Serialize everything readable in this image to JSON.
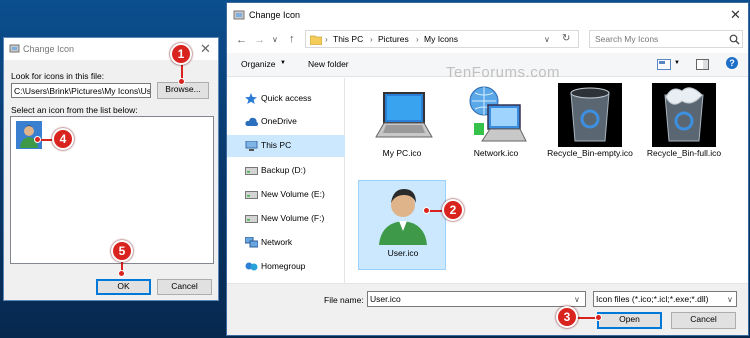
{
  "small_dialog": {
    "title": "Change Icon",
    "look_label": "Look for icons in this file:",
    "file_path": "C:\\Users\\Brink\\Pictures\\My Icons\\Use",
    "browse_label": "Browse...",
    "list_label": "Select an icon from the list below:",
    "ok_label": "OK",
    "cancel_label": "Cancel"
  },
  "open_dialog": {
    "title": "Change Icon",
    "breadcrumb": [
      "This PC",
      "Pictures",
      "My Icons"
    ],
    "search_placeholder": "Search My Icons",
    "organize_label": "Organize",
    "new_folder_label": "New folder",
    "watermark": "TenForums.com",
    "nav_items": [
      {
        "label": "Quick access",
        "icon": "star-icon"
      },
      {
        "label": "OneDrive",
        "icon": "cloud-icon"
      },
      {
        "label": "This PC",
        "icon": "computer-icon",
        "selected": true
      },
      {
        "label": "Backup (D:)",
        "icon": "drive-icon"
      },
      {
        "label": "New Volume (E:)",
        "icon": "drive-icon"
      },
      {
        "label": "New Volume (F:)",
        "icon": "drive-icon"
      },
      {
        "label": "Network",
        "icon": "network-icon"
      },
      {
        "label": "Homegroup",
        "icon": "homegroup-icon"
      }
    ],
    "files": [
      {
        "name": "My PC.ico"
      },
      {
        "name": "Network.ico"
      },
      {
        "name": "Recycle_Bin-empty.ico"
      },
      {
        "name": "Recycle_Bin-full.ico"
      },
      {
        "name": "User.ico",
        "selected": true
      }
    ],
    "file_name_label": "File name:",
    "file_name_value": "User.ico",
    "file_type": "Icon files (*.ico;*.icl;*.exe;*.dll)",
    "open_label": "Open",
    "cancel_label": "Cancel"
  },
  "steps": [
    "1",
    "2",
    "3",
    "4",
    "5"
  ],
  "colors": {
    "step_red": "#d8231e",
    "selection": "#cce8ff",
    "accent": "#0078d7"
  }
}
